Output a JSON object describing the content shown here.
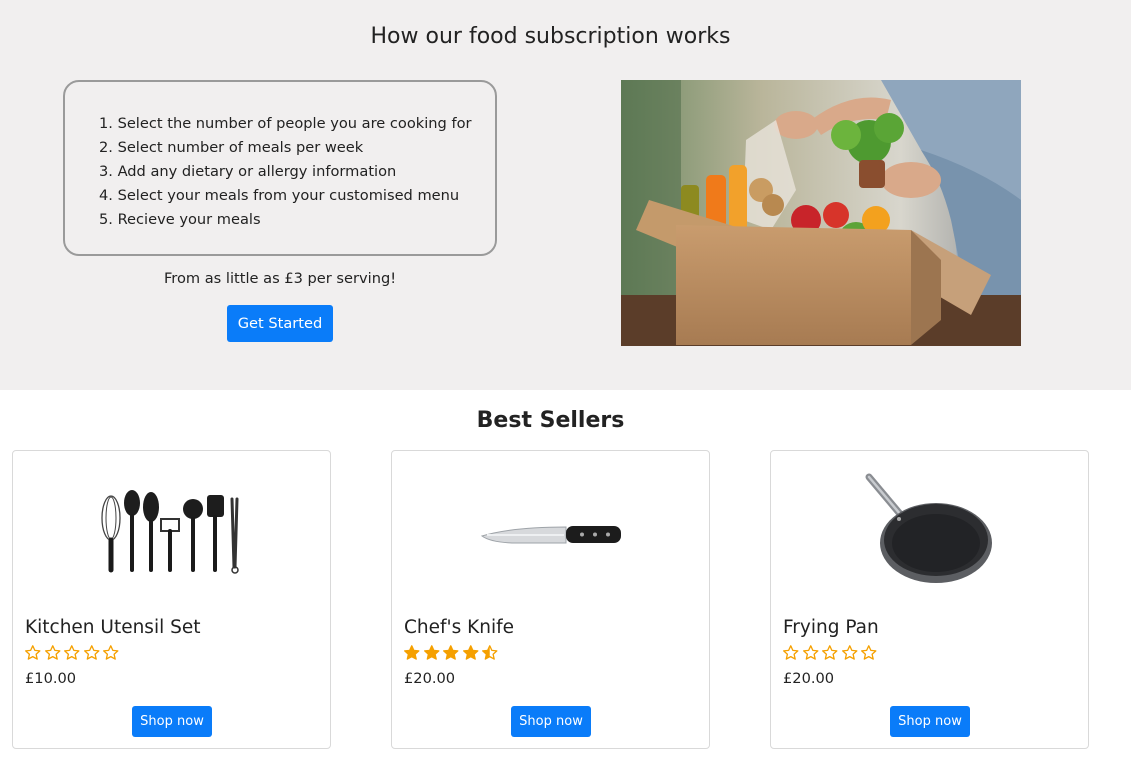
{
  "hero": {
    "title": "How our food subscription works",
    "steps": [
      "1. Select the number of people you are cooking for",
      "2. Select number of meals per week",
      "3. Add any dietary or allergy information",
      "4. Select your meals from your customised menu",
      "5. Recieve your meals"
    ],
    "price_text": "From as little as £3 per serving!",
    "cta_label": "Get Started",
    "image_icon": "grocery-box-photo"
  },
  "best_sellers": {
    "title": "Best Sellers",
    "products": [
      {
        "name": "Kitchen Utensil Set",
        "rating": 0,
        "rating_max": 5,
        "price": "£10.00",
        "button": "Shop now",
        "image_icon": "utensil-set"
      },
      {
        "name": "Chef's Knife",
        "rating": 4.5,
        "rating_max": 5,
        "price": "£20.00",
        "button": "Shop now",
        "image_icon": "chef-knife"
      },
      {
        "name": "Frying Pan",
        "rating": 0,
        "rating_max": 5,
        "price": "£20.00",
        "button": "Shop now",
        "image_icon": "frying-pan"
      }
    ]
  },
  "colors": {
    "accent": "#0a7cf9",
    "star": "#f5a000",
    "hero_bg": "#f1efef"
  }
}
